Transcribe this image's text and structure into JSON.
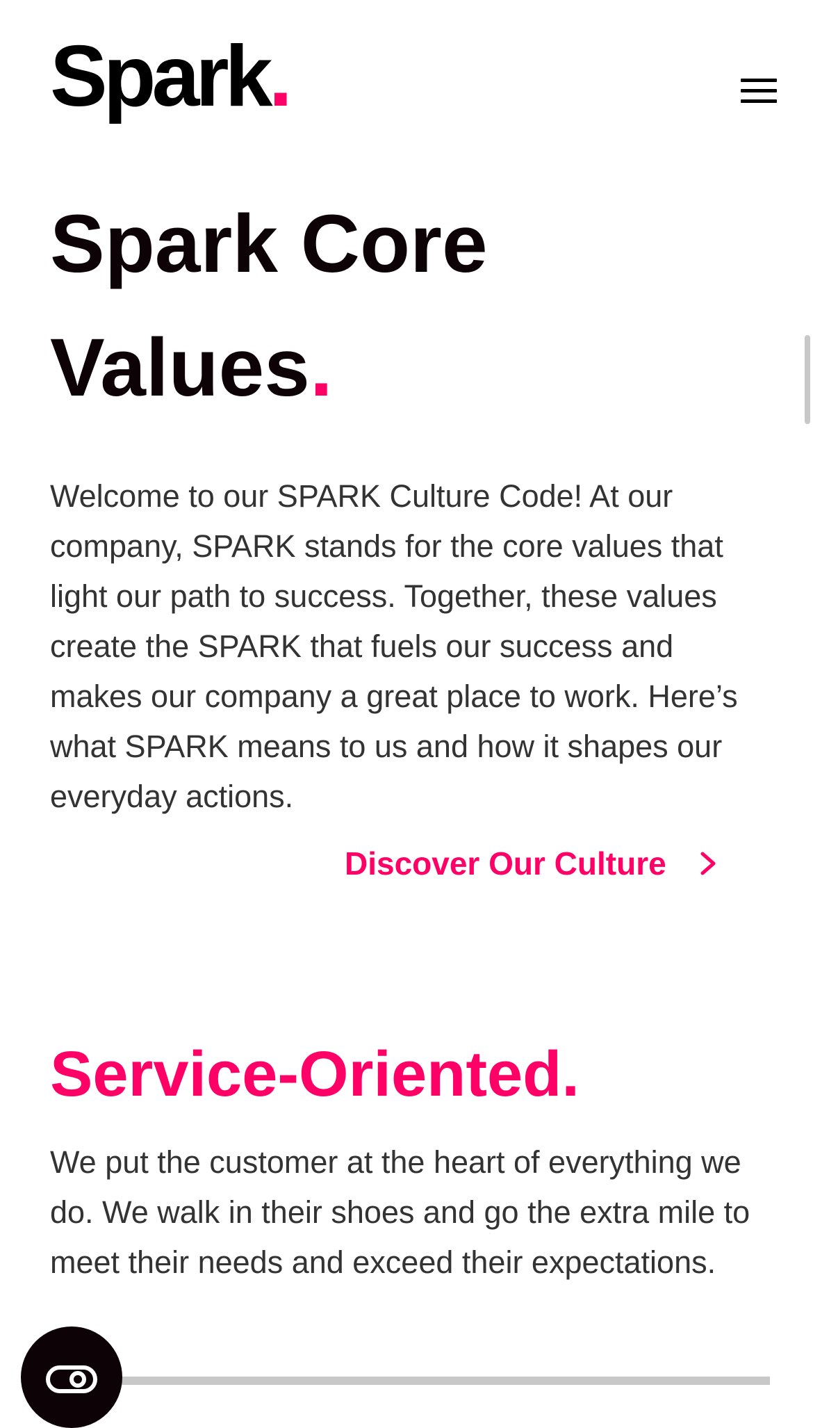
{
  "header": {
    "logo_text": "Spark",
    "logo_dot": ".",
    "menu_icon": "hamburger-menu-icon"
  },
  "hero": {
    "title_line1": "Spark Core",
    "title_line2": "Values",
    "title_dot": ".",
    "intro": "Welcome to our SPARK Culture Code! At our company, SPARK stands for the core values that light our path to success. Together, these values create the SPARK that fuels our success and makes our company a great place to work. Here’s what SPARK means to us and how it shapes our everyday actions.",
    "cta_label": "Discover Our Culture",
    "cta_icon": "chevron-right-icon"
  },
  "section": {
    "title": "Service-Oriented.",
    "text": "We put the customer at the heart of everything we do. We walk in their shoes and go the extra mile to meet their needs and exceed their expectations."
  },
  "chat": {
    "icon": "chat-bubble-icon"
  },
  "colors": {
    "accent": "#ff0066",
    "heading": "#0d0206",
    "body_text": "#333333"
  }
}
